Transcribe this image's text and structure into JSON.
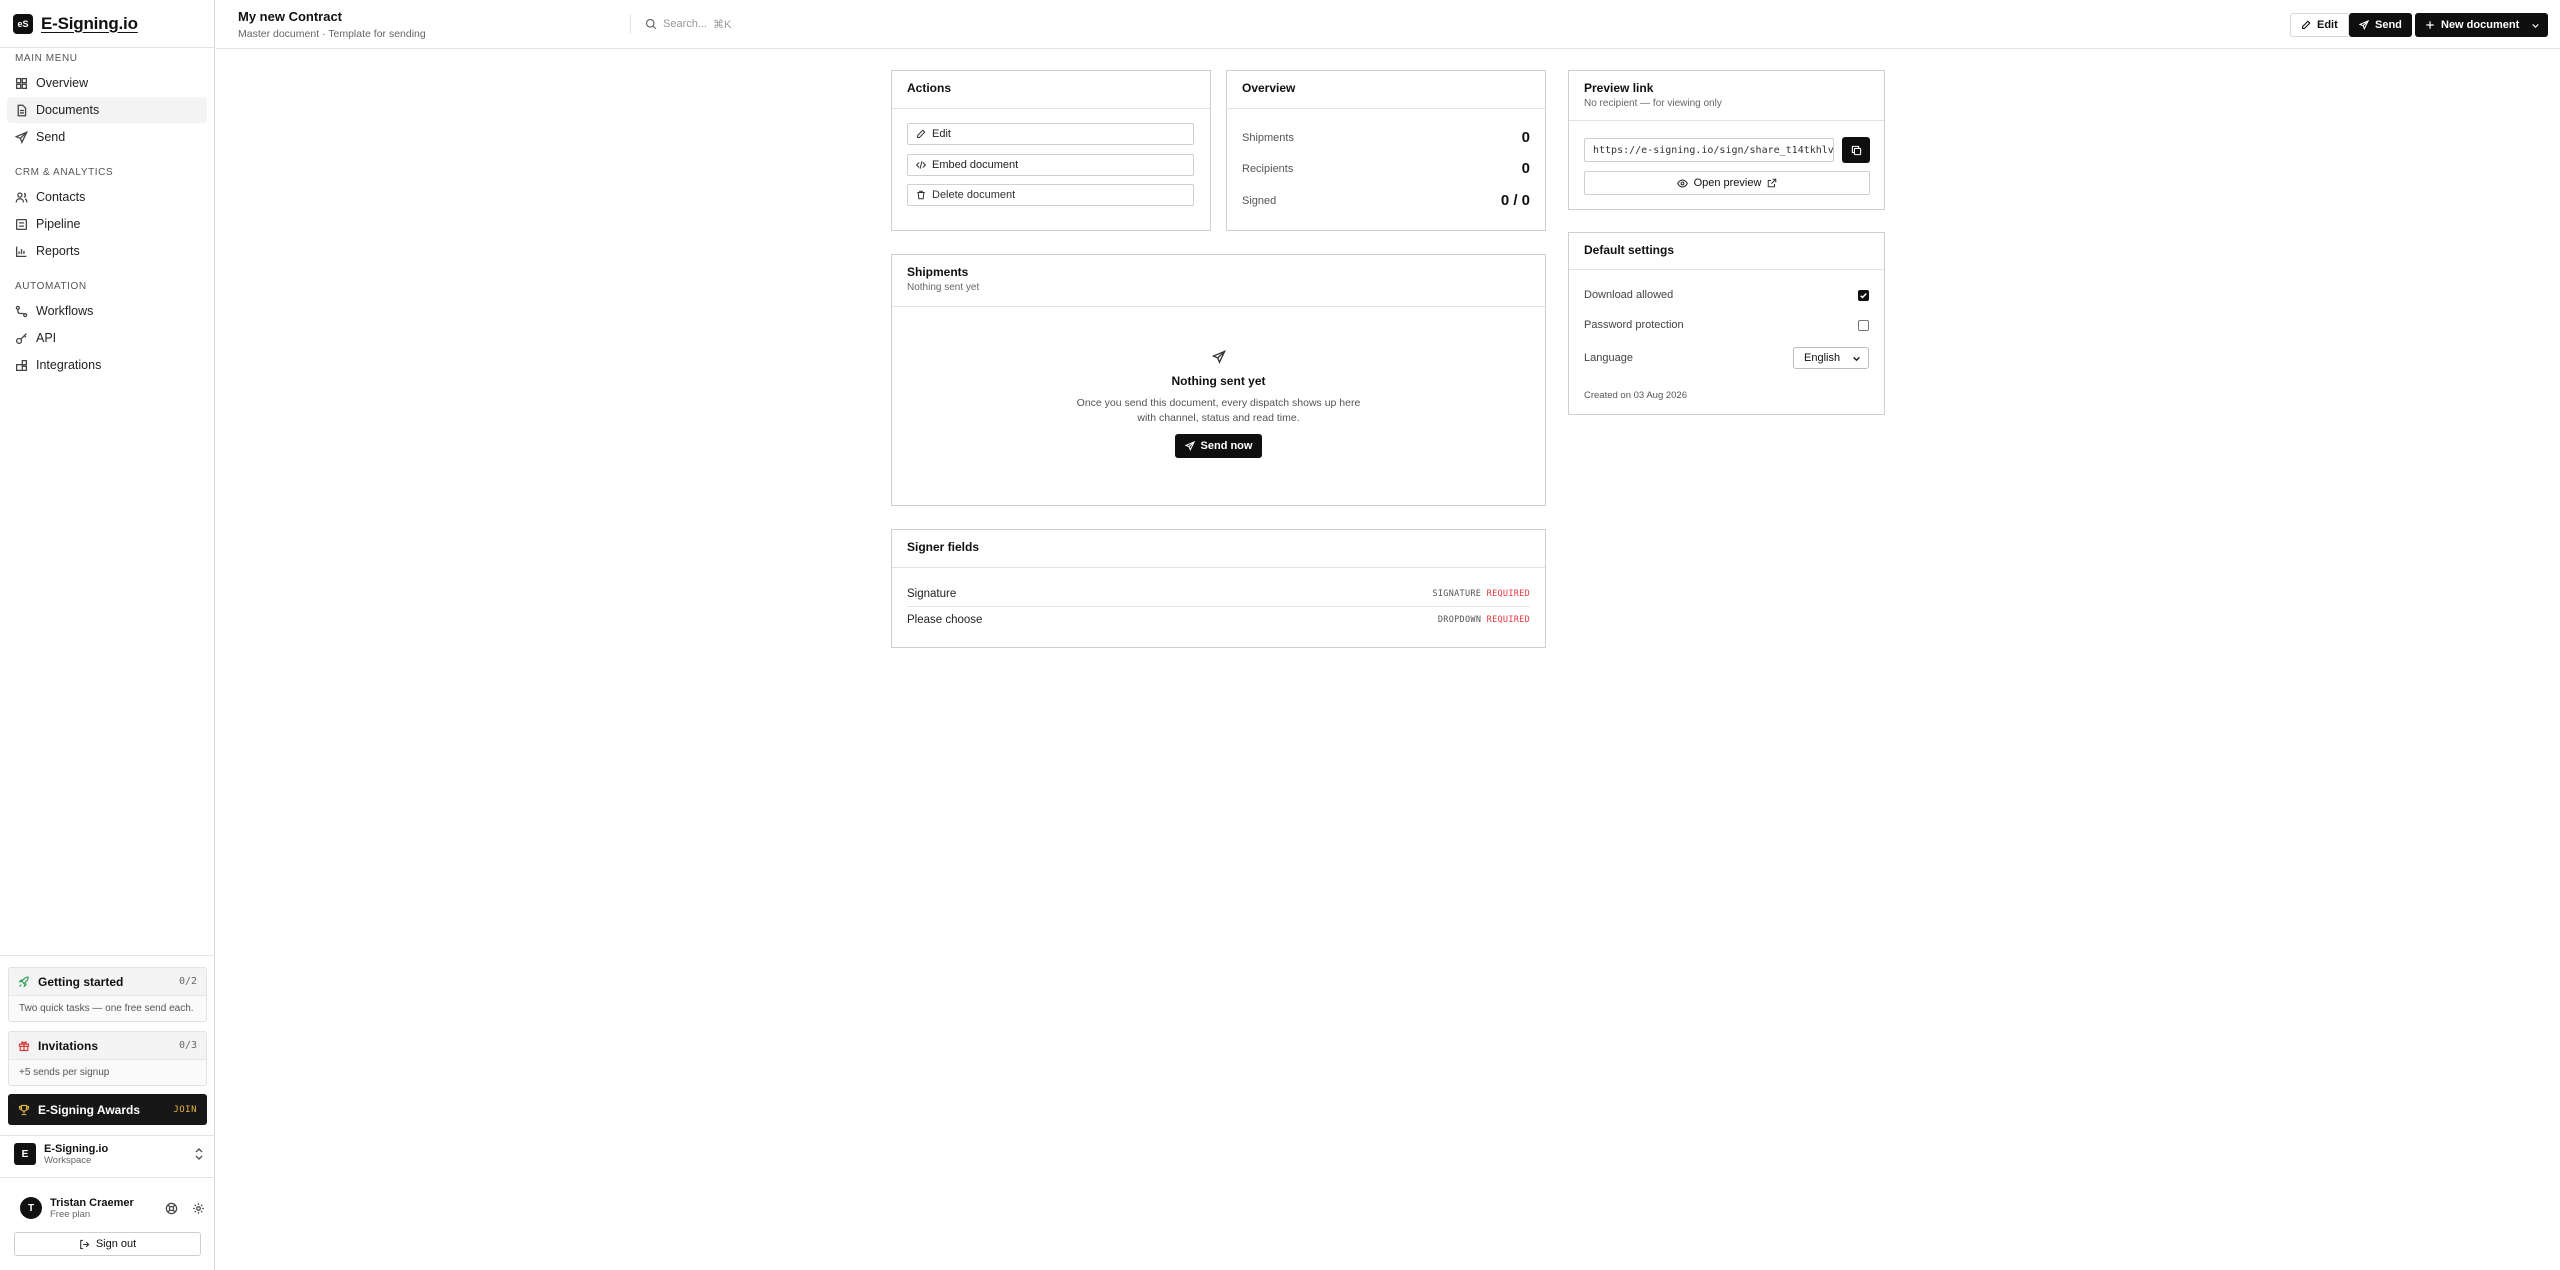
{
  "app": {
    "logo_mark": "eS",
    "name": "E-Signing.io"
  },
  "sidebar": {
    "sections": [
      {
        "title": "MAIN MENU",
        "items": [
          {
            "label": "Overview",
            "icon": "grid-icon"
          },
          {
            "label": "Documents",
            "icon": "document-icon",
            "active": true
          },
          {
            "label": "Send",
            "icon": "send-icon"
          }
        ]
      },
      {
        "title": "CRM & ANALYTICS",
        "items": [
          {
            "label": "Contacts",
            "icon": "users-icon"
          },
          {
            "label": "Pipeline",
            "icon": "list-icon"
          },
          {
            "label": "Reports",
            "icon": "bar-chart-icon"
          }
        ]
      },
      {
        "title": "AUTOMATION",
        "items": [
          {
            "label": "Workflows",
            "icon": "workflow-icon"
          },
          {
            "label": "API",
            "icon": "key-icon"
          },
          {
            "label": "Integrations",
            "icon": "blocks-icon"
          }
        ]
      }
    ],
    "getting_started": {
      "title": "Getting started",
      "count": "0/2",
      "desc": "Two quick tasks — one free send each."
    },
    "invitations": {
      "title": "Invitations",
      "count": "0/3",
      "desc": "+5 sends per signup"
    },
    "awards": {
      "title": "E-Signing Awards",
      "cta": "JOIN"
    },
    "workspace": {
      "initial": "E",
      "name": "E-Signing.io",
      "sub": "Workspace"
    },
    "user": {
      "initial": "T",
      "name": "Tristan Craemer",
      "plan": "Free plan"
    },
    "sign_out": "Sign out"
  },
  "topbar": {
    "title": "My new Contract",
    "subtitle": "Master document · Template for sending",
    "search_placeholder": "Search...",
    "search_shortcut": "⌘K",
    "edit_label": "Edit",
    "send_label": "Send",
    "new_doc_label": "New document"
  },
  "actions": {
    "title": "Actions",
    "edit": "Edit",
    "embed": "Embed document",
    "delete": "Delete document"
  },
  "overview": {
    "title": "Overview",
    "rows": [
      {
        "label": "Shipments",
        "value": "0"
      },
      {
        "label": "Recipients",
        "value": "0"
      },
      {
        "label": "Signed",
        "value": "0 / 0"
      }
    ]
  },
  "preview": {
    "title": "Preview link",
    "subtitle": "No recipient — for viewing only",
    "url": "https://e-signing.io/sign/share_t14tkhlvf…",
    "open_label": "Open preview"
  },
  "settings": {
    "title": "Default settings",
    "download_label": "Download allowed",
    "download_checked": true,
    "password_label": "Password protection",
    "password_checked": false,
    "language_label": "Language",
    "language_value": "English",
    "created": "Created on 03 Aug 2026"
  },
  "shipments": {
    "title": "Shipments",
    "subtitle": "Nothing sent yet",
    "empty_title": "Nothing sent yet",
    "empty_line1": "Once you send this document, every dispatch shows up here",
    "empty_line2": "with channel, status and read time.",
    "send_now": "Send now"
  },
  "signer_fields": {
    "title": "Signer fields",
    "fields": [
      {
        "name": "Signature",
        "type": "SIGNATURE",
        "required": "REQUIRED"
      },
      {
        "name": "Please choose",
        "type": "DROPDOWN",
        "required": "REQUIRED"
      }
    ]
  }
}
